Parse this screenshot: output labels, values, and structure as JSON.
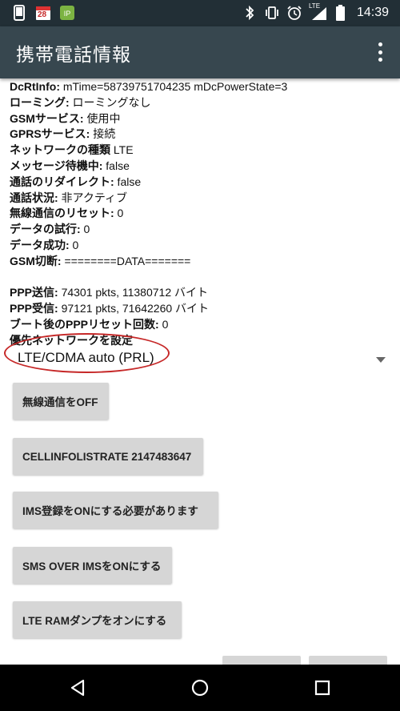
{
  "status_bar": {
    "time": "14:39",
    "calendar_day": "28",
    "network_type": "LTE",
    "icons": [
      "phone-icon",
      "calendar-icon",
      "app-notification-icon",
      "bluetooth-icon",
      "vibrate-icon",
      "alarm-icon",
      "signal-icon",
      "battery-icon"
    ]
  },
  "app_bar": {
    "title": "携帯電話情報",
    "overflow_icon": "more-vert-icon"
  },
  "info": [
    {
      "label": "DcRtInfo:",
      "value": " mTime=58739751704235 mDcPowerState=3"
    },
    {
      "label": "ローミング:",
      "value": " ローミングなし"
    },
    {
      "label": "GSMサービス:",
      "value": " 使用中"
    },
    {
      "label": "GPRSサービス:",
      "value": " 接続"
    },
    {
      "label": "ネットワークの種類",
      "value": " LTE"
    },
    {
      "label": "メッセージ待機中:",
      "value": " false"
    },
    {
      "label": "通話のリダイレクト:",
      "value": " false"
    },
    {
      "label": "通話状況:",
      "value": " 非アクティブ"
    },
    {
      "label": "無線通信のリセット:",
      "value": " 0"
    },
    {
      "label": "データの試行:",
      "value": " 0"
    },
    {
      "label": "データ成功:",
      "value": " 0"
    },
    {
      "label": "GSM切断:",
      "value": " ========DATA======="
    }
  ],
  "ppp": [
    {
      "label": "PPP送信:",
      "value": " 74301 pkts, 11380712 バイト"
    },
    {
      "label": "PPP受信:",
      "value": " 97121 pkts, 71642260 バイト"
    },
    {
      "label": "ブート後のPPPリセット回数:",
      "value": " 0"
    },
    {
      "label": "優先ネットワークを設定",
      "value": ""
    }
  ],
  "spinner": {
    "selected": "LTE/CDMA auto (PRL)",
    "arrow_icon": "dropdown-arrow-icon"
  },
  "buttons": {
    "radio_off": "無線通信をOFF",
    "cellinfo": "CELLINFOLISTRATE 2147483647",
    "ims_reg": "IMS登録をONにする必要があります",
    "sms_ims": "SMS OVER IMSをONにする",
    "lte_ram": "LTE RAMダンプをオンにする"
  },
  "colors": {
    "status_bar": "#222f36",
    "app_bar": "#37474f",
    "button": "#d6d6d6",
    "annotation": "#c62828"
  }
}
